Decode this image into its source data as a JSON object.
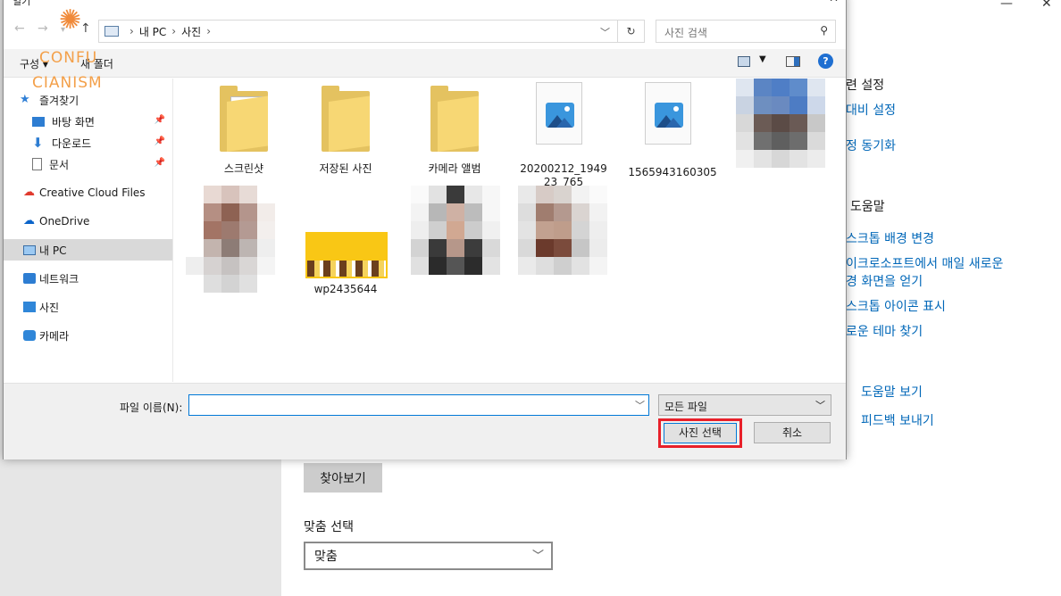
{
  "background": {
    "related_settings_heading": "련 설정",
    "links_top": [
      "대비 설정",
      "정 동기화"
    ],
    "help_heading": "도움말",
    "links_help": [
      "스크톱 배경 변경",
      "이크로소프트에서 매일 새로운",
      "경 화면을 얻기",
      "스크톱 아이콘 표시",
      "로운 테마 찾기"
    ],
    "links_bottom": [
      "도움말 보기",
      "피드백 보내기"
    ],
    "browse_button": "찾아보기",
    "fit_label": "맞춤 선택",
    "fit_value": "맞춤"
  },
  "dialog": {
    "title": "열기",
    "address": {
      "segments": [
        "내 PC",
        "사진"
      ]
    },
    "search_placeholder": "사진 검색",
    "toolbar": {
      "organize": "구성 ▾",
      "new_folder": "새 폴더",
      "help": "?"
    },
    "watermark": {
      "line1": "CONFU",
      "line2": "CIANISM"
    },
    "nav": [
      {
        "label": "즐겨찾기",
        "icon": "star-icon"
      },
      {
        "label": "바탕 화면",
        "icon": "desktop-icon",
        "pinned": true
      },
      {
        "label": "다운로드",
        "icon": "download-icon",
        "pinned": true
      },
      {
        "label": "문서",
        "icon": "document-icon",
        "pinned": true
      },
      {
        "label": "Creative Cloud Files",
        "icon": "creative-cloud-icon"
      },
      {
        "label": "OneDrive",
        "icon": "onedrive-icon"
      },
      {
        "label": "내 PC",
        "icon": "pc-icon",
        "selected": true
      },
      {
        "label": "네트워크",
        "icon": "network-icon"
      },
      {
        "label": "사진",
        "icon": "pictures-icon"
      },
      {
        "label": "카메라",
        "icon": "camera-icon"
      }
    ],
    "files": [
      {
        "name": "스크린샷",
        "kind": "folder"
      },
      {
        "name": "저장된 사진",
        "kind": "folder"
      },
      {
        "name": "카메라 앨범",
        "kind": "folder"
      },
      {
        "name": "20200212_194923_765",
        "kind": "image",
        "name_line1": "20200212_1949",
        "name_line2": "23_765"
      },
      {
        "name": "1565943160305",
        "kind": "image"
      },
      {
        "name": "",
        "kind": "blurred"
      },
      {
        "name": "",
        "kind": "blurred"
      },
      {
        "name": "wp2435644",
        "kind": "thumbnail"
      },
      {
        "name": "",
        "kind": "blurred"
      },
      {
        "name": "",
        "kind": "blurred"
      }
    ],
    "file_name_label": "파일 이름(N):",
    "file_name_value": "",
    "file_type": "모든 파일",
    "open_button": "사진 선택",
    "cancel_button": "취소"
  },
  "colors": {
    "link": "#0067b8",
    "highlight_box": "#e8202a",
    "selected_nav": "#d9d9d9",
    "accent": "#0078d7"
  }
}
